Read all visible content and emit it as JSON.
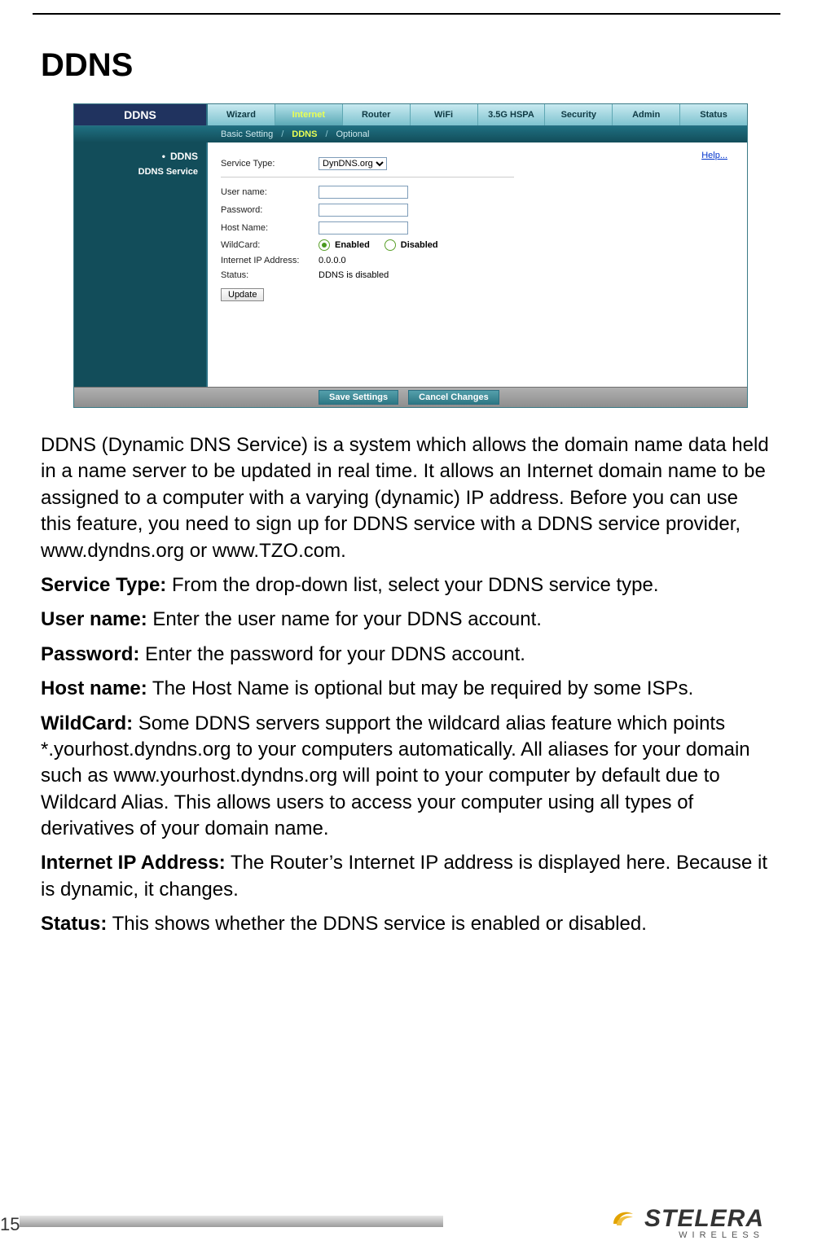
{
  "page": {
    "title": "DDNS",
    "number": "15"
  },
  "router_ui": {
    "page_badge": "DDNS",
    "tabs": [
      "Wizard",
      "Internet",
      "Router",
      "WiFi",
      "3.5G HSPA",
      "Security",
      "Admin",
      "Status"
    ],
    "active_tab_index": 1,
    "subtabs": {
      "before": "Basic Setting",
      "active": "DDNS",
      "after": "Optional"
    },
    "side": {
      "heading": "DDNS",
      "item": "DDNS Service"
    },
    "help_link": "Help...",
    "form": {
      "service_type_label": "Service Type:",
      "service_type_value": "DynDNS.org",
      "username_label": "User name:",
      "password_label": "Password:",
      "hostname_label": "Host Name:",
      "wildcard_label": "WildCard:",
      "wildcard_enabled": "Enabled",
      "wildcard_disabled": "Disabled",
      "ip_label": "Internet IP Address:",
      "ip_value": "0.0.0.0",
      "status_label": "Status:",
      "status_value": "DDNS is disabled",
      "update_button": "Update"
    },
    "footer": {
      "save": "Save Settings",
      "cancel": "Cancel Changes"
    }
  },
  "doc": {
    "intro": "DDNS (Dynamic DNS Service) is a system which allows the domain name data held in a name server to be updated in real time. It allows an Internet domain name to be assigned to a computer with a varying (dynamic) IP address. Before you can use this feature, you need to sign up for DDNS service with a DDNS service provider, www.dyndns.org or www.TZO.com.",
    "service_type_term": "Service Type:",
    "service_type_text": " From the drop-down list, select your DDNS service type.",
    "username_term": "User name:",
    "username_text": " Enter the user name for your DDNS account.",
    "password_term": "Password:",
    "password_text": " Enter the password for your DDNS account.",
    "hostname_term": "Host name:",
    "hostname_text": " The Host Name is optional but may be required by some ISPs.",
    "wildcard_term": "WildCard:",
    "wildcard_text": " Some DDNS servers support the wildcard alias feature which points *.yourhost.dyndns.org to your computers automatically. All aliases for your domain such as www.yourhost.dyndns.org will point to your computer by default due to Wildcard Alias. This allows users to access your computer using all types of derivatives of your domain name.",
    "ip_term": "Internet IP Address:",
    "ip_text": " The Router’s Internet IP address is displayed here. Because it is dynamic, it changes.",
    "status_term": "Status:",
    "status_text": " This shows whether the DDNS service is enabled or disabled."
  },
  "brand": {
    "name": "STELERA",
    "sub": "WIRELESS"
  }
}
